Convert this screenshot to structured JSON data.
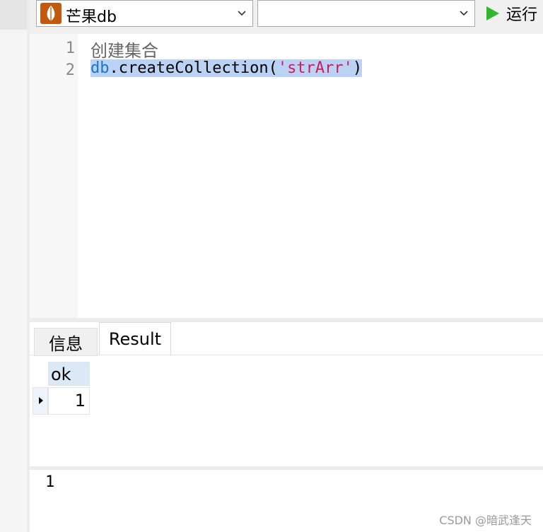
{
  "toolbar": {
    "database": "芒果db",
    "collection": "",
    "run_label": "运行"
  },
  "editor": {
    "lines": [
      {
        "number": "1",
        "text": "创建集合"
      },
      {
        "number": "2",
        "code": {
          "object": "db",
          "dot": ".",
          "method": "createCollection",
          "open": "(",
          "arg": "'strArr'",
          "close": ")"
        }
      }
    ]
  },
  "tabs": [
    {
      "label": "信息"
    },
    {
      "label": "Result",
      "active": true
    }
  ],
  "result_grid": {
    "columns": [
      "ok"
    ],
    "rows": [
      [
        "1"
      ]
    ]
  },
  "status": {
    "value": "1"
  },
  "watermark": "CSDN @暗武逢天",
  "colors": {
    "selection": "#bad3f4",
    "keyword": "#1976d2",
    "string": "#d11a5a",
    "run_icon": "#2eb82e",
    "db_icon": "#c15a0f"
  }
}
